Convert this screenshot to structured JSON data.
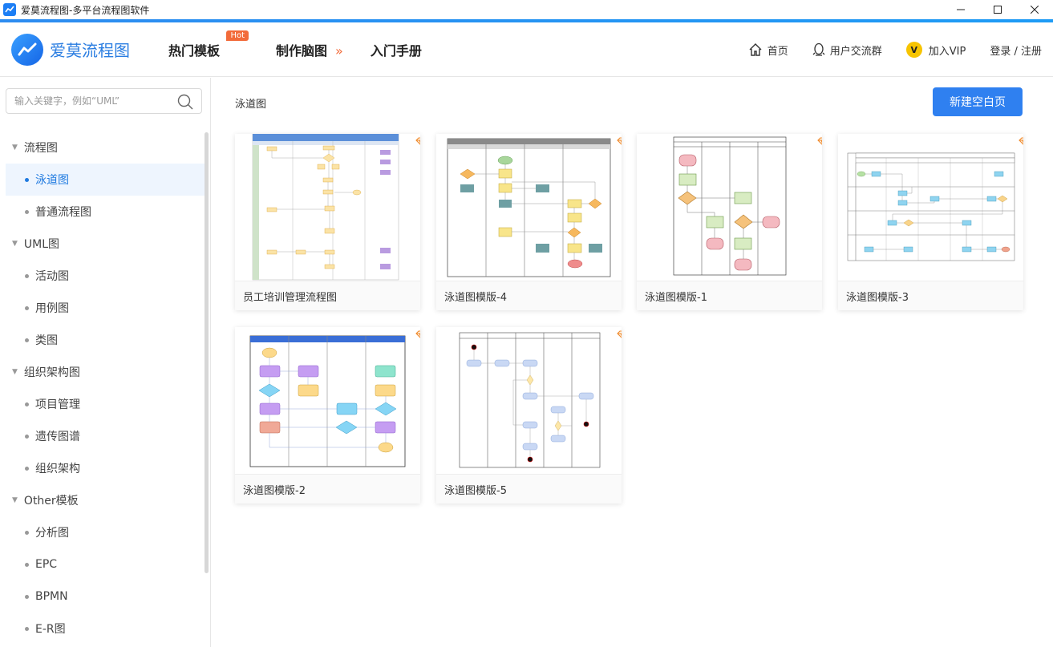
{
  "window": {
    "title": "爱莫流程图-多平台流程图软件"
  },
  "header": {
    "logo_text": "爱莫流程图",
    "nav": {
      "hot_templates": "热门模板",
      "hot_badge": "Hot",
      "make_mindmap": "制作脑图",
      "guide": "入门手册"
    },
    "right": {
      "home": "首页",
      "community": "用户交流群",
      "vip": "加入VIP",
      "login": "登录 / 注册"
    }
  },
  "sidebar": {
    "search_placeholder": "输入关键字，例如“UML”",
    "tree": [
      {
        "type": "group",
        "label": "流程图"
      },
      {
        "type": "child",
        "label": "泳道图",
        "active": true
      },
      {
        "type": "child",
        "label": "普通流程图"
      },
      {
        "type": "group",
        "label": "UML图"
      },
      {
        "type": "child",
        "label": "活动图"
      },
      {
        "type": "child",
        "label": "用例图"
      },
      {
        "type": "child",
        "label": "类图"
      },
      {
        "type": "group",
        "label": "组织架构图"
      },
      {
        "type": "child",
        "label": "项目管理"
      },
      {
        "type": "child",
        "label": "遗传图谱"
      },
      {
        "type": "child",
        "label": "组织架构"
      },
      {
        "type": "group",
        "label": "Other模板"
      },
      {
        "type": "child",
        "label": "分析图"
      },
      {
        "type": "child",
        "label": "EPC"
      },
      {
        "type": "child",
        "label": "BPMN"
      },
      {
        "type": "child",
        "label": "E-R图"
      }
    ]
  },
  "main": {
    "breadcrumb": "泳道图",
    "new_blank_button": "新建空白页",
    "cards": [
      {
        "label": "员工培训管理流程图"
      },
      {
        "label": "泳道图模版-4"
      },
      {
        "label": "泳道图模版-1"
      },
      {
        "label": "泳道图模版-3"
      },
      {
        "label": "泳道图模版-2"
      },
      {
        "label": "泳道图模版-5"
      }
    ]
  },
  "colors": {
    "accent": "#2f80f0",
    "hot": "#f26b3a",
    "vip": "#f7c400",
    "active_bg": "#eef5fe"
  }
}
